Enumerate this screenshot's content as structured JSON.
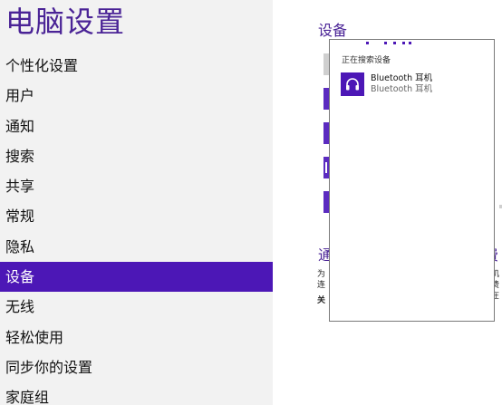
{
  "app": {
    "title": "电脑设置"
  },
  "nav": {
    "items": [
      {
        "label": "个性化设置"
      },
      {
        "label": "用户"
      },
      {
        "label": "通知"
      },
      {
        "label": "搜索"
      },
      {
        "label": "共享"
      },
      {
        "label": "常规"
      },
      {
        "label": "隐私"
      },
      {
        "label": "设备"
      },
      {
        "label": "无线"
      },
      {
        "label": "轻松使用"
      },
      {
        "label": "同步你的设置"
      },
      {
        "label": "家庭组"
      }
    ],
    "selected": "设备"
  },
  "main": {
    "section_title": "设备",
    "background_heading_left": "通",
    "background_heading_right": "费",
    "background_text_lines": [
      "为",
      "连",
      "关"
    ],
    "background_text_right_lines": [
      "机",
      "费",
      "在"
    ]
  },
  "flyout": {
    "status_text": "正在搜索设备",
    "devices": [
      {
        "name": "Bluetooth 耳机",
        "description": "Bluetooth 耳机",
        "icon": "headset-icon"
      }
    ]
  },
  "colors": {
    "accent": "#4c17b6",
    "title": "#4a2396",
    "left_pane_bg": "#f2f2f2"
  }
}
